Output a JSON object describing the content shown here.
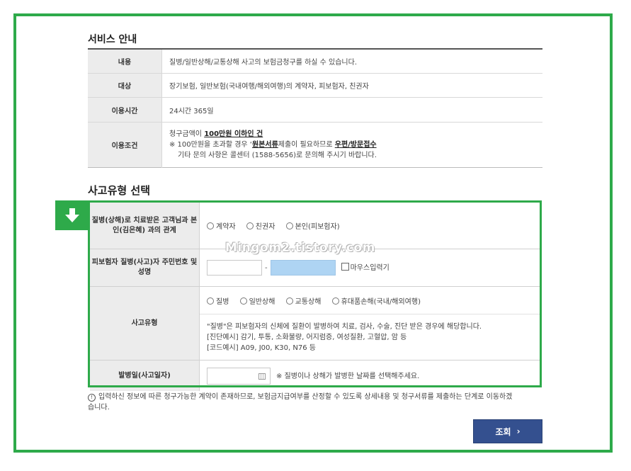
{
  "service": {
    "title": "서비스 안내",
    "rows": [
      {
        "label": "내용",
        "value": "질병/일반상해/교통상해 사고의 보험금청구를 하실 수 있습니다."
      },
      {
        "label": "대상",
        "value": "장기보험, 일반보험(국내여행/해외여행)의 계약자, 피보험자, 친권자"
      },
      {
        "label": "이용시간",
        "value": "24시간 365일"
      },
      {
        "label": "이용조건",
        "line1_prefix": "청구금액이 ",
        "line1_bold": "100만원 이하인 건",
        "line2_prefix": "※ 100만원을 초과할 경우 ‘",
        "line2_bold1": "원본서류",
        "line2_mid": "제출이 필요하므로 ",
        "line2_bold2": "우편/방문접수",
        "line3": "기타 문의 사항은 콜센터 (1588-5656)로 문의해 주시기 바랍니다."
      }
    ]
  },
  "accident": {
    "title": "사고유형 선택",
    "relation_label": "질병(상해)로 치료받은 고객님과 본인(김은혜) 과의 관계",
    "relation_options": [
      "계약자",
      "친권자",
      "본인(피보험자)"
    ],
    "id_label": "피보험자 질병(사고)자 주민번호 및 성명",
    "id_dash": "-",
    "mouse_input_label": "마우스입력기",
    "type_label": "사고유형",
    "type_options": [
      "질병",
      "일반상해",
      "교통상해",
      "휴대품손해(국내/해외여행)"
    ],
    "type_note1": "\"질병\"은 피보험자의 신체에 질환이 발병하여 치료, 검사, 수술, 진단 받은 경우에 해당합니다.",
    "type_note2": "[진단예시] 감기, 투통, 소화불량, 어지럼증, 여성질환, 고혈압, 암 등",
    "type_note3": "[코드예시] A09, J00, K30, N76 등",
    "date_label": "발병일(사고일자)",
    "date_note": "※ 질병이나 상해가 발병한 날짜를 선택해주세요."
  },
  "watermark": "Mingom2.tistory.com",
  "footnote": {
    "icon": "!",
    "text": "입력하신 정보에 따른 청구가능한 계약이 존재하므로, 보험금지급여부를 산정할 수 있도록 상세내용 및 청구서류를 제출하는 단계로 이동하겠습니다."
  },
  "search_button": {
    "label": "조회",
    "chevron": "›"
  },
  "colors": {
    "highlight_green": "#2eaa4a",
    "button_navy": "#34508f",
    "id_field_blue": "#aed4f3"
  }
}
